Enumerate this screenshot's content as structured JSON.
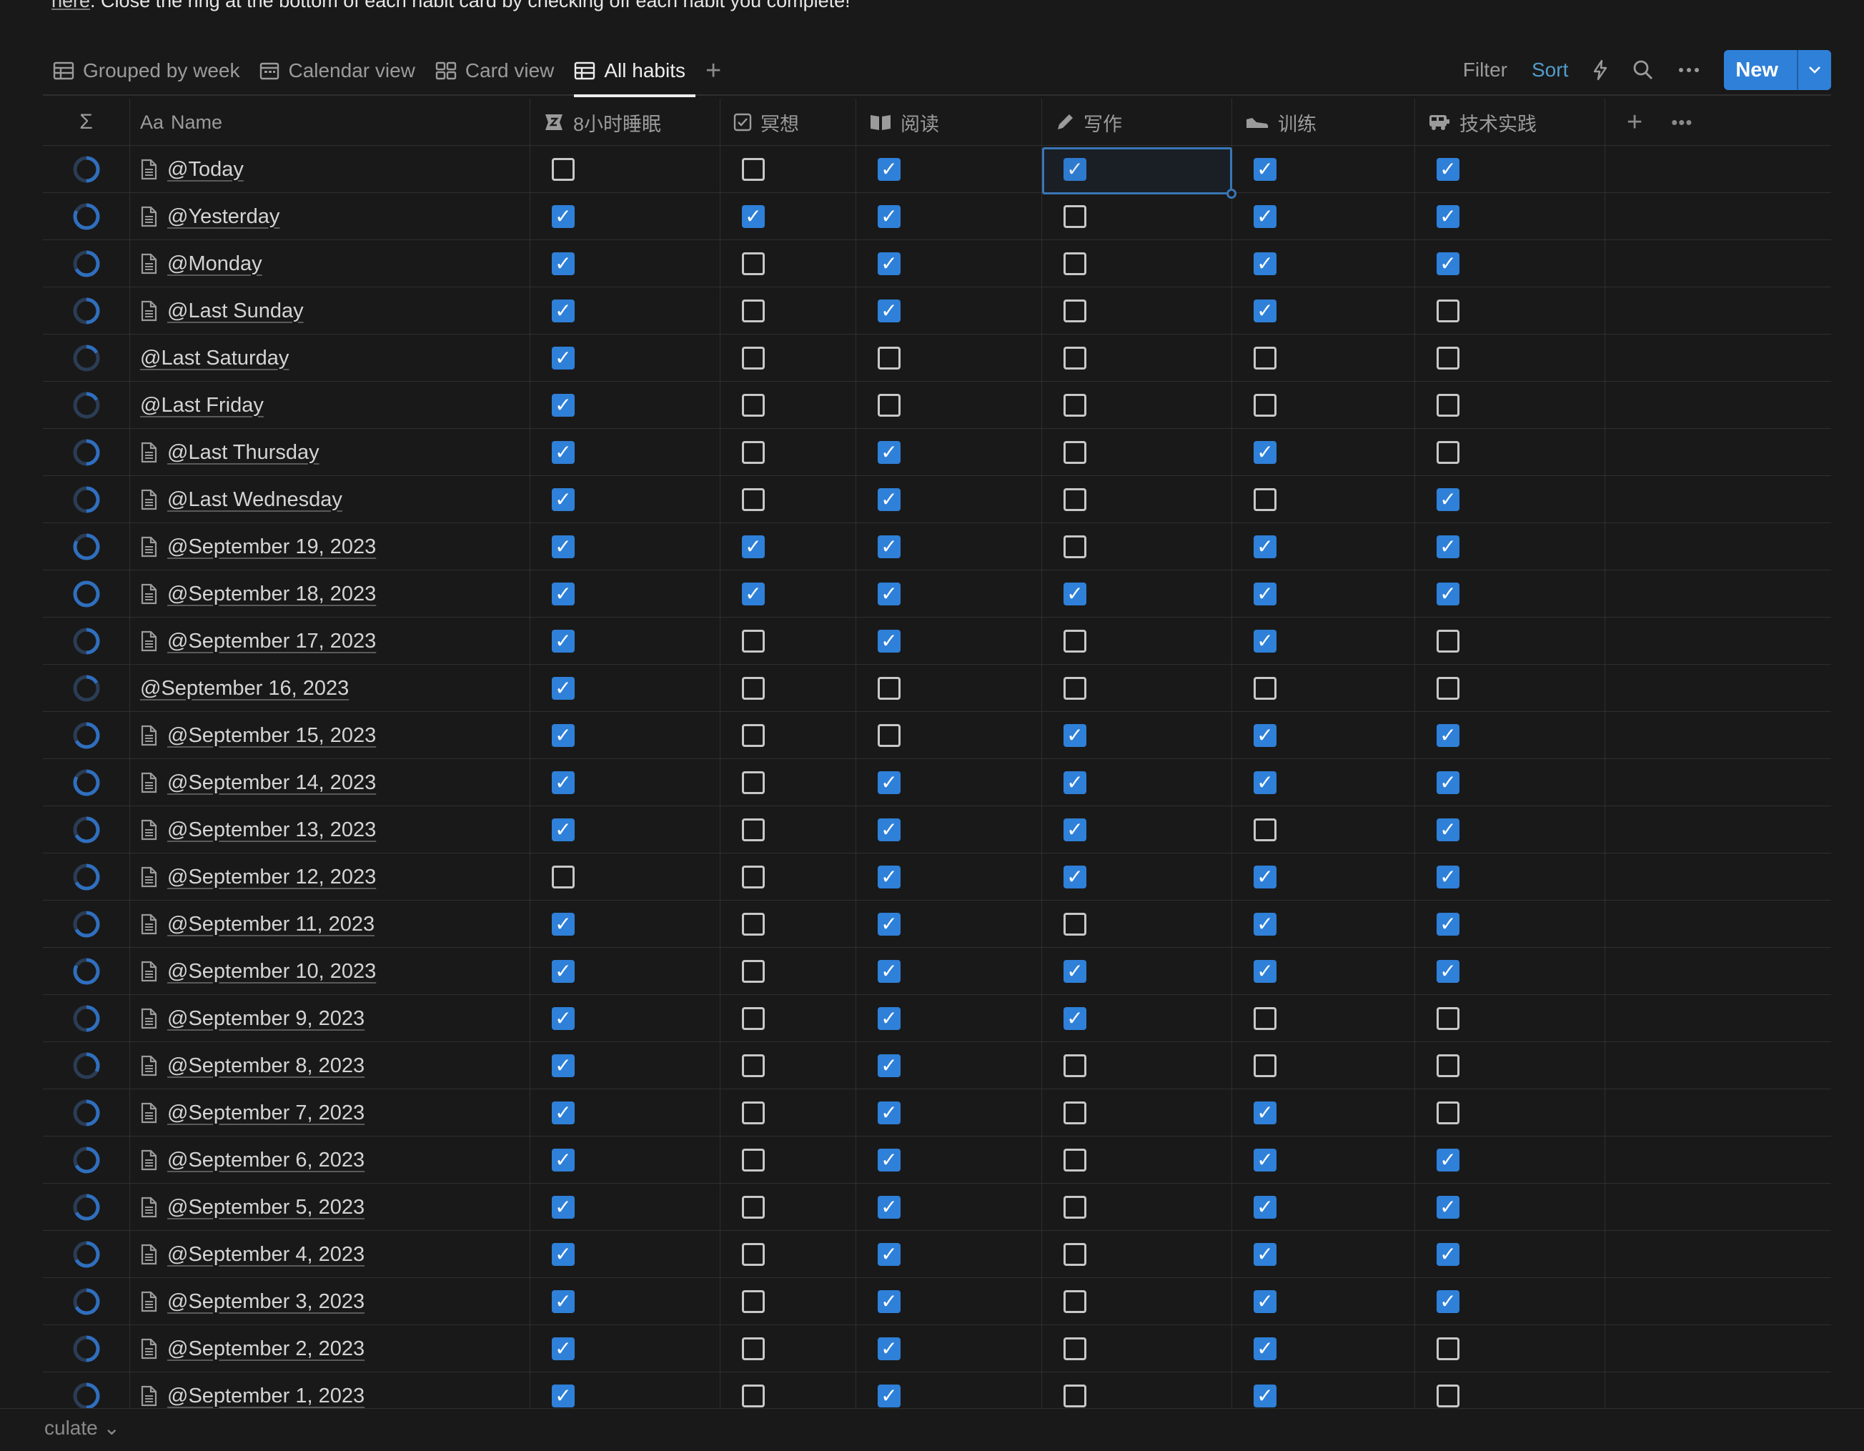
{
  "description": {
    "link_text": "here",
    "rest_text": ". Close the ring at the bottom of each habit card by checking off each habit you complete!"
  },
  "tabs": [
    {
      "label": "Grouped by week",
      "icon": "table-icon",
      "active": false
    },
    {
      "label": "Calendar view",
      "icon": "calendar-icon",
      "active": false
    },
    {
      "label": "Card view",
      "icon": "gallery-icon",
      "active": false
    },
    {
      "label": "All habits",
      "icon": "table-icon",
      "active": true
    }
  ],
  "actions": {
    "filter": "Filter",
    "sort": "Sort",
    "new": "New"
  },
  "colors": {
    "accent": "#2f80d8",
    "sort": "#529cca",
    "background": "#191919",
    "ring": "#2f6fbf"
  },
  "columns": {
    "name": "Name",
    "habits": [
      "8小时睡眠",
      "冥想",
      "阅读",
      "写作",
      "训练",
      "技术实践"
    ],
    "habit_icons": [
      "sleep-icon",
      "checkbox-icon",
      "book-icon",
      "pencil-icon",
      "shoe-icon",
      "bus-icon"
    ]
  },
  "rows": [
    {
      "name": "@Today",
      "doc": true,
      "progress": 0.5,
      "checks": [
        0,
        0,
        1,
        1,
        1,
        1
      ]
    },
    {
      "name": "@Yesterday",
      "doc": true,
      "progress": 0.83,
      "checks": [
        1,
        1,
        1,
        0,
        1,
        1
      ]
    },
    {
      "name": "@Monday",
      "doc": true,
      "progress": 0.67,
      "checks": [
        1,
        0,
        1,
        0,
        1,
        1
      ]
    },
    {
      "name": "@Last Sunday",
      "doc": true,
      "progress": 0.5,
      "checks": [
        1,
        0,
        1,
        0,
        1,
        0
      ]
    },
    {
      "name": "@Last Saturday",
      "doc": false,
      "progress": 0.17,
      "checks": [
        1,
        0,
        0,
        0,
        0,
        0
      ]
    },
    {
      "name": "@Last Friday",
      "doc": false,
      "progress": 0.17,
      "checks": [
        1,
        0,
        0,
        0,
        0,
        0
      ]
    },
    {
      "name": "@Last Thursday",
      "doc": true,
      "progress": 0.5,
      "checks": [
        1,
        0,
        1,
        0,
        1,
        0
      ]
    },
    {
      "name": "@Last Wednesday",
      "doc": true,
      "progress": 0.5,
      "checks": [
        1,
        0,
        1,
        0,
        0,
        1
      ]
    },
    {
      "name": "@September 19, 2023",
      "doc": true,
      "progress": 0.83,
      "checks": [
        1,
        1,
        1,
        0,
        1,
        1
      ]
    },
    {
      "name": "@September 18, 2023",
      "doc": true,
      "progress": 1,
      "checks": [
        1,
        1,
        1,
        1,
        1,
        1
      ]
    },
    {
      "name": "@September 17, 2023",
      "doc": true,
      "progress": 0.5,
      "checks": [
        1,
        0,
        1,
        0,
        1,
        0
      ]
    },
    {
      "name": "@September 16, 2023",
      "doc": false,
      "progress": 0.17,
      "checks": [
        1,
        0,
        0,
        0,
        0,
        0
      ]
    },
    {
      "name": "@September 15, 2023",
      "doc": true,
      "progress": 0.67,
      "checks": [
        1,
        0,
        0,
        1,
        1,
        1
      ]
    },
    {
      "name": "@September 14, 2023",
      "doc": true,
      "progress": 0.83,
      "checks": [
        1,
        0,
        1,
        1,
        1,
        1
      ]
    },
    {
      "name": "@September 13, 2023",
      "doc": true,
      "progress": 0.67,
      "checks": [
        1,
        0,
        1,
        1,
        0,
        1
      ]
    },
    {
      "name": "@September 12, 2023",
      "doc": true,
      "progress": 0.67,
      "checks": [
        0,
        0,
        1,
        1,
        1,
        1
      ]
    },
    {
      "name": "@September 11, 2023",
      "doc": true,
      "progress": 0.67,
      "checks": [
        1,
        0,
        1,
        0,
        1,
        1
      ]
    },
    {
      "name": "@September 10, 2023",
      "doc": true,
      "progress": 0.83,
      "checks": [
        1,
        0,
        1,
        1,
        1,
        1
      ]
    },
    {
      "name": "@September 9, 2023",
      "doc": true,
      "progress": 0.5,
      "checks": [
        1,
        0,
        1,
        1,
        0,
        0
      ]
    },
    {
      "name": "@September 8, 2023",
      "doc": true,
      "progress": 0.33,
      "checks": [
        1,
        0,
        1,
        0,
        0,
        0
      ]
    },
    {
      "name": "@September 7, 2023",
      "doc": true,
      "progress": 0.5,
      "checks": [
        1,
        0,
        1,
        0,
        1,
        0
      ]
    },
    {
      "name": "@September 6, 2023",
      "doc": true,
      "progress": 0.67,
      "checks": [
        1,
        0,
        1,
        0,
        1,
        1
      ]
    },
    {
      "name": "@September 5, 2023",
      "doc": true,
      "progress": 0.67,
      "checks": [
        1,
        0,
        1,
        0,
        1,
        1
      ]
    },
    {
      "name": "@September 4, 2023",
      "doc": true,
      "progress": 0.67,
      "checks": [
        1,
        0,
        1,
        0,
        1,
        1
      ]
    },
    {
      "name": "@September 3, 2023",
      "doc": true,
      "progress": 0.67,
      "checks": [
        1,
        0,
        1,
        0,
        1,
        1
      ]
    },
    {
      "name": "@September 2, 2023",
      "doc": true,
      "progress": 0.5,
      "checks": [
        1,
        0,
        1,
        0,
        1,
        0
      ]
    },
    {
      "name": "@September 1, 2023",
      "doc": true,
      "progress": 0.5,
      "checks": [
        1,
        0,
        1,
        0,
        1,
        0
      ]
    }
  ],
  "footer": {
    "calculate": "culate"
  }
}
